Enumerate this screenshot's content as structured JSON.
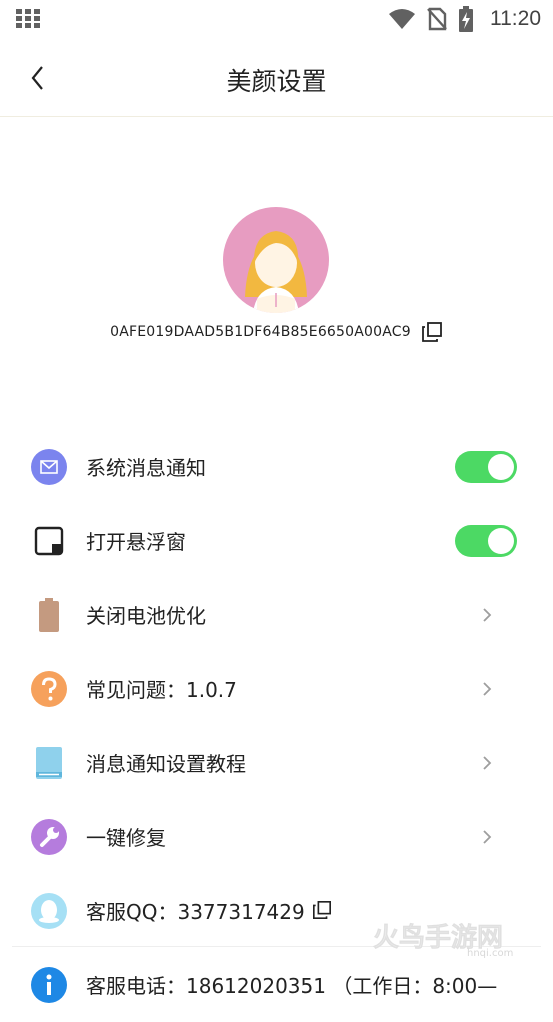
{
  "status_bar": {
    "time": "11:20"
  },
  "header": {
    "title": "美颜设置"
  },
  "profile": {
    "device_id": "0AFE019DAAD5B1DF64B85E6650A00AC9"
  },
  "settings": {
    "items": [
      {
        "label": "系统消息通知",
        "icon": "mail-icon",
        "control": "toggle",
        "on": true
      },
      {
        "label": "打开悬浮窗",
        "icon": "floating-window-icon",
        "control": "toggle",
        "on": true
      },
      {
        "label": "关闭电池优化",
        "icon": "battery-icon",
        "control": "chevron"
      },
      {
        "label": "常见问题：1.0.7",
        "icon": "question-icon",
        "control": "chevron"
      },
      {
        "label": "消息通知设置教程",
        "icon": "book-icon",
        "control": "chevron"
      },
      {
        "label": "一键修复",
        "icon": "wrench-icon",
        "control": "chevron"
      },
      {
        "label": "客服QQ：3377317429",
        "icon": "qq-icon",
        "control": "copy"
      },
      {
        "label": "客服电话：18612020351 （工作日：8:00—",
        "icon": "info-icon",
        "control": "none"
      }
    ]
  },
  "colors": {
    "toggle_on": "#4cd964",
    "avatar_bg": "#e79cc1",
    "mail": "#7b84ee",
    "battery": "#c49a80",
    "question": "#f6a15c",
    "book": "#8fd1ec",
    "wrench": "#b57cdd",
    "qq": "#a6e0f5",
    "info": "#1e88e5"
  },
  "watermark": {
    "text": "火鸟手游网",
    "sub": "hnqi.com"
  }
}
